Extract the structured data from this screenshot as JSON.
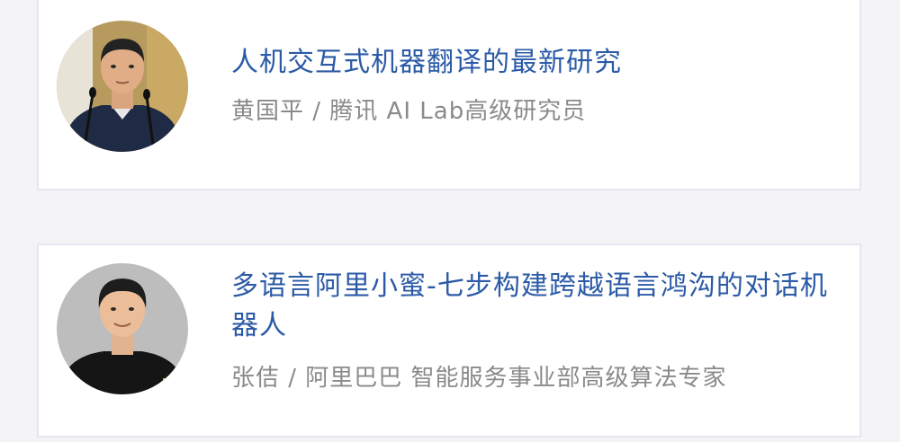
{
  "talks": [
    {
      "title": "人机交互式机器翻译的最新研究",
      "speaker": "黄国平 / 腾讯 AI Lab高级研究员",
      "avatar_icon": "speaker-photo"
    },
    {
      "title": "多语言阿里小蜜-七步构建跨越语言鸿沟的对话机器人",
      "speaker": "张佶 / 阿里巴巴 智能服务事业部高级算法专家",
      "avatar_icon": "speaker-photo"
    }
  ],
  "colors": {
    "title": "#2b5aa6",
    "speaker": "#8a8a8a",
    "background": "#f4f4f6",
    "card_border": "#e6e7ee"
  }
}
